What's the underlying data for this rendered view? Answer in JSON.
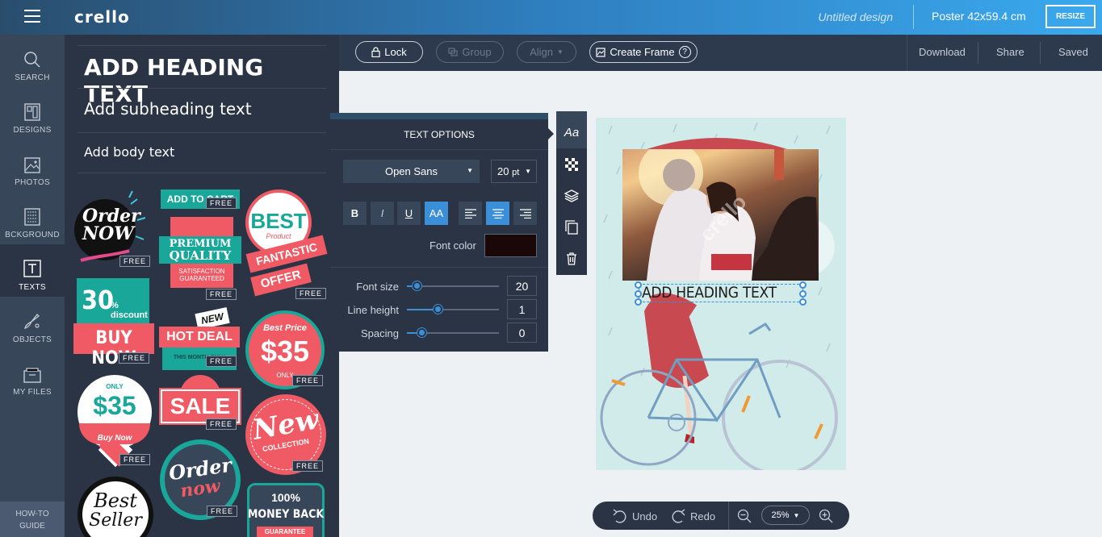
{
  "header": {
    "logo": "crello",
    "title": "Untitled design",
    "format": "Poster 42x59.4 cm",
    "resize_label": "RESIZE"
  },
  "nav": {
    "items": [
      {
        "label": "SEARCH",
        "icon": "search-icon"
      },
      {
        "label": "DESIGNS",
        "icon": "designs-icon"
      },
      {
        "label": "PHOTOS",
        "icon": "photos-icon"
      },
      {
        "label": "BCKGROUND",
        "icon": "background-icon"
      },
      {
        "label": "TEXTS",
        "icon": "texts-icon",
        "active": true
      },
      {
        "label": "OBJECTS",
        "icon": "objects-icon"
      },
      {
        "label": "MY FILES",
        "icon": "files-icon"
      }
    ],
    "howto_line1": "HOW-TO",
    "howto_line2": "GUIDE"
  },
  "texts_panel": {
    "heading": "ADD HEADING TEXT",
    "subheading": "Add subheading text",
    "body": "Add body text",
    "free_badge": "FREE",
    "stickers": {
      "order_now": "Order NOW",
      "add_to_cart": "ADD TO CART",
      "premium": "PREMIUM",
      "quality": "QUALITY",
      "satisfaction": "SATISFACTION GUARANTEED",
      "best": "BEST",
      "product": "Product",
      "fantastic": "FANTASTIC",
      "offer": "OFFER",
      "thirty": "30",
      "discount": "% discount",
      "buy_now": "BUY NOW",
      "new_small": "NEW",
      "hot_deal": "HOT DEAL",
      "this_month": "THIS MONTH ONLY",
      "best_price": "Best Price",
      "dollar35": "$35",
      "only": "ONLY",
      "only_top": "ONLY",
      "buy_now_small": "Buy Now",
      "sale": "SALE",
      "new_big": "New",
      "collection": "COLLECTION",
      "best_w": "Best",
      "seller": "Seller",
      "order_w": "Order",
      "now_w": "now",
      "money1": "100%",
      "money2": "MONEY BACK",
      "guarantee": "GUARANTEE"
    }
  },
  "toolbar": {
    "lock": "Lock",
    "group": "Group",
    "align": "Align",
    "create_frame": "Create Frame",
    "download": "Download",
    "share": "Share",
    "saved": "Saved"
  },
  "text_options": {
    "title": "TEXT OPTIONS",
    "font": "Open Sans",
    "size_select": "20",
    "size_unit": "pt",
    "bold": "B",
    "italic": "I",
    "underline": "U",
    "caps": "AA",
    "font_color_label": "Font color",
    "font_color": "#1a0707",
    "sliders": [
      {
        "label": "Font size",
        "value": "20",
        "fraction": 0.11
      },
      {
        "label": "Line height",
        "value": "1",
        "fraction": 0.34
      },
      {
        "label": "Spacing",
        "value": "0",
        "fraction": 0.16
      }
    ]
  },
  "side_tools": {
    "text": "Aa"
  },
  "canvas": {
    "heading_text": "ADD HEADING TEXT",
    "watermark": "crello"
  },
  "bottom": {
    "undo": "Undo",
    "redo": "Redo",
    "zoom": "25%"
  },
  "colors": {
    "accent": "#3a8fd8",
    "panel": "#2b3444",
    "canvas_bg": "#d1eaea"
  }
}
